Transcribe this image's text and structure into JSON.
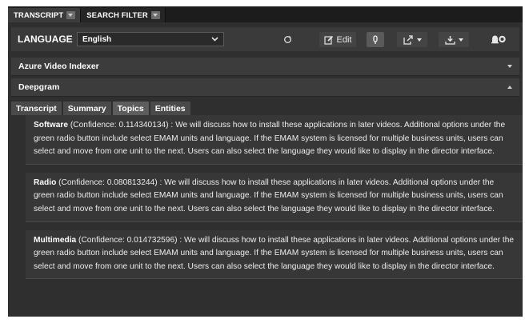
{
  "top_tabs": [
    {
      "label": "TRANSCRIPT"
    },
    {
      "label": "SEARCH FILTER"
    }
  ],
  "language": {
    "label": "LANGUAGE",
    "selected": "English"
  },
  "toolbar": {
    "edit_label": "Edit",
    "icons": [
      "refresh-icon",
      "edit-icon",
      "microphone-icon",
      "share-icon",
      "download-icon",
      "notification-icon"
    ]
  },
  "accordions": [
    {
      "title": "Azure Video Indexer",
      "state": "collapsed"
    },
    {
      "title": "Deepgram",
      "state": "expanded"
    }
  ],
  "inner_tabs": [
    {
      "label": "Transcript"
    },
    {
      "label": "Summary"
    },
    {
      "label": "Topics"
    },
    {
      "label": "Entities"
    }
  ],
  "active_inner_tab": "Topics",
  "topics": [
    {
      "name": "Software",
      "details": " (Confidence: 0.114340134) : We will discuss how to install these applications in later videos. Additional options under the green radio button include select EMAM units and language. If the EMAM system is licensed for multiple business units, users can select and move from one unit to the next. Users can also select the language they would like to display in the director interface."
    },
    {
      "name": "Radio",
      "details": " (Confidence: 0.080813244) : We will discuss how to install these applications in later videos. Additional options under the green radio button include select EMAM units and language. If the EMAM system is licensed for multiple business units, users can select and move from one unit to the next. Users can also select the language they would like to display in the director interface."
    },
    {
      "name": "Multimedia",
      "details": " (Confidence: 0.014732596) : We will discuss how to install these applications in later videos. Additional options under the green radio button include select EMAM units and language. If the EMAM system is licensed for multiple business units, users can select and move from one unit to the next. Users can also select the language they would like to display in the director interface."
    }
  ],
  "colors": {
    "panel_bg": "#2f2f2f",
    "header_bg": "#3c3c3c",
    "active_tab": "#5d5d5d"
  }
}
